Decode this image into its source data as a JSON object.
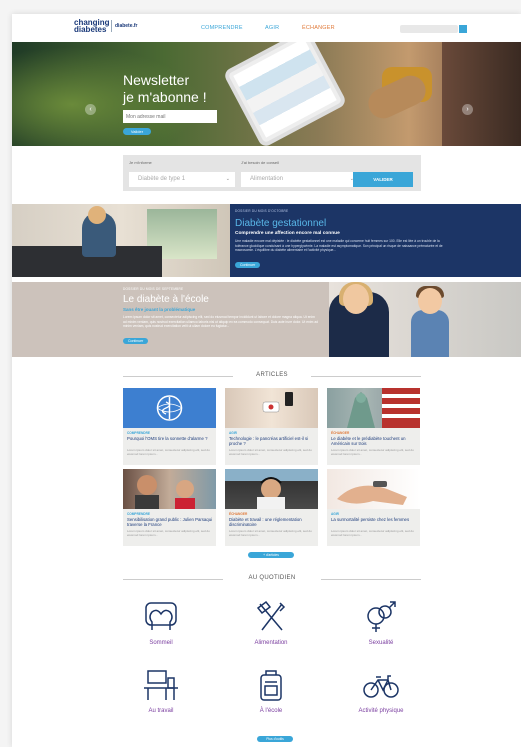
{
  "header": {
    "logo_line1": "changing",
    "logo_line2": "diabetes",
    "logo_site": "diabete.fr",
    "nav": [
      {
        "label": "COMPRENDRE",
        "color": "#3aa6d8"
      },
      {
        "label": "AGIR",
        "color": "#3aa6d8"
      },
      {
        "label": "ÉCHANGER",
        "color": "#e07a3a"
      }
    ]
  },
  "hero": {
    "title_line1": "Newsletter",
    "title_line2": "je m'abonne !",
    "input_placeholder": "Mon adresse mail",
    "button": "Valider",
    "prev_icon": "‹",
    "next_icon": "›"
  },
  "filter": {
    "label1": "Je m'informe",
    "label2": "J'ai besoin de conseil",
    "select1": "Diabète de type 1",
    "select2": "Alimentation",
    "button": "VALIDER"
  },
  "feature1": {
    "tag": "DOSSIER DU MOIS D'OCTOBRE",
    "title": "Diabète gestationnel",
    "subtitle": "Comprendre une affection encore mal connue",
    "body": "Une maladie encore mal dépistée : le diabète gestationnel est une maladie qui concerne huit femmes sur 100. Elle est liée à un trouble de la tolérance glucidique conduisant à une hyperglycémie. La maladie est asymptomatique. Son principal un risque de naissance prématurée et de macrosomie. L'équilibre du diabète alimentaire et l'activité physique...",
    "button": "Continuer"
  },
  "feature2": {
    "tag": "DOSSIER DU MOIS DE SEPTEMBRE",
    "title": "Le diabète à l'école",
    "subtitle": "Sans être jouant la problématique",
    "body": "Lorem ipsum dolor sit amet, consectetur adipiscing elit, sed do eiusmod tempor incididunt ut labore et dolore magna aliqua. Ut enim ad minim veniam, quis nostrud exercitation ullamco laboris nisi ut aliquip ex ea commodo consequat. Duis aute irure dolor. Ut enim ad minim veniam, quis nostrud exercitation velit ut ullam dolore eu fugiatur...",
    "button": "Continuer"
  },
  "articles": {
    "heading": "ARTICLES",
    "more_button": "+ d'articles",
    "excerpt": "Lorem ipsum dolor sit amet, consectetur adipiscing elit, sed do eiusmod lorem ipsum...",
    "items": [
      {
        "category": "COMPRENDRE",
        "cat_color": "#3aa6d8",
        "title": "Pourquoi l'OMS tire la sonnette d'alarme ?"
      },
      {
        "category": "AGIR",
        "cat_color": "#3aa6d8",
        "title": "Technologie : le pancréas artificiel est-il si proche ?"
      },
      {
        "category": "ÉCHANGER",
        "cat_color": "#e07a3a",
        "title": "Le diabète et le prédiabète touchent un Américain sur trois"
      },
      {
        "category": "COMPRENDRE",
        "cat_color": "#3aa6d8",
        "title": "Sensibilisation grand public : Julien Parsaqui traverse la France"
      },
      {
        "category": "ÉCHANGER",
        "cat_color": "#e07a3a",
        "title": "Diabète et travail : une réglementation discriminatoire"
      },
      {
        "category": "AGIR",
        "cat_color": "#3aa6d8",
        "title": "La surmortalité persiste chez les femmes"
      }
    ]
  },
  "daily": {
    "heading": "AU QUOTIDIEN",
    "more_button": "Plus d'outils",
    "items": [
      {
        "label": "Sommeil",
        "icon": "sleep-icon"
      },
      {
        "label": "Alimentation",
        "icon": "cutlery-icon"
      },
      {
        "label": "Sexualité",
        "icon": "gender-icon"
      },
      {
        "label": "Au travail",
        "icon": "desk-icon"
      },
      {
        "label": "À l'école",
        "icon": "backpack-icon"
      },
      {
        "label": "Activité physique",
        "icon": "bicycle-icon"
      }
    ]
  },
  "colors": {
    "accent": "#3aa6d8",
    "navy": "#1c3566",
    "purple": "#7b3fa0",
    "orange": "#e07a3a"
  }
}
